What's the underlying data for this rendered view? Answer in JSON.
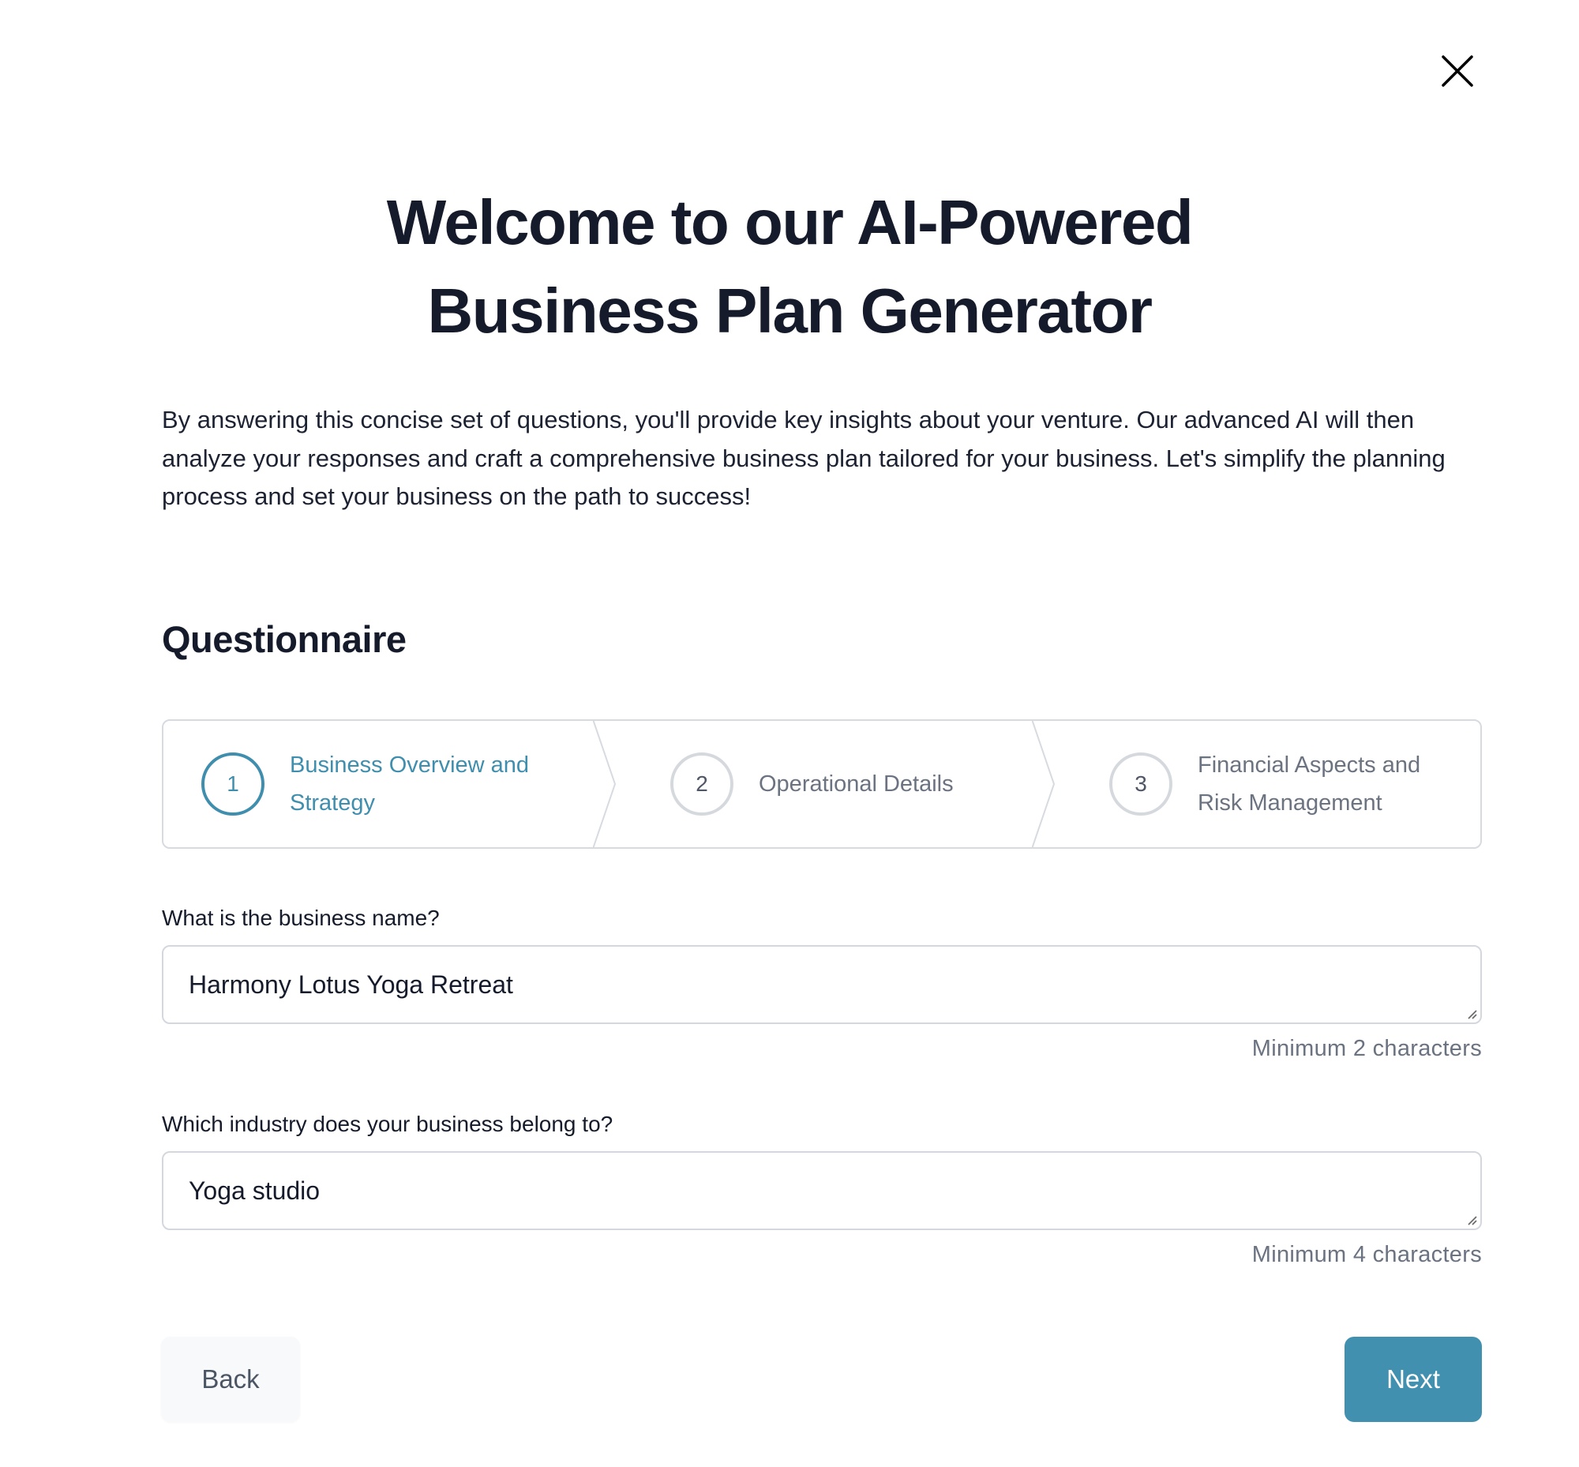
{
  "header": {
    "close_icon": "close-x-icon",
    "title_line1": "Welcome to our AI-Powered",
    "title_line2": "Business Plan Generator"
  },
  "intro": {
    "text": "By answering this concise set of questions, you'll provide key insights about your venture. Our advanced AI will then analyze your responses and craft a comprehensive business plan tailored for your business. Let's simplify the planning process and set your business on the path to success!"
  },
  "questionnaire": {
    "title": "Questionnaire",
    "steps": [
      {
        "number": "1",
        "label": "Business Overview and Strategy",
        "state": "active"
      },
      {
        "number": "2",
        "label": "Operational Details",
        "state": "inactive"
      },
      {
        "number": "3",
        "label": "Financial Aspects and Risk Management",
        "state": "inactive"
      }
    ],
    "fields": [
      {
        "label": "What is the business name?",
        "value": "Harmony Lotus Yoga Retreat",
        "helper": "Minimum 2 characters"
      },
      {
        "label": "Which industry does your business belong to?",
        "value": "Yoga studio",
        "helper": "Minimum 4 characters"
      }
    ]
  },
  "actions": {
    "back_label": "Back",
    "next_label": "Next"
  },
  "colors": {
    "accent": "#4190b0",
    "text_primary": "#151b2b",
    "text_muted": "#6b7280",
    "border": "#d4d8de"
  }
}
